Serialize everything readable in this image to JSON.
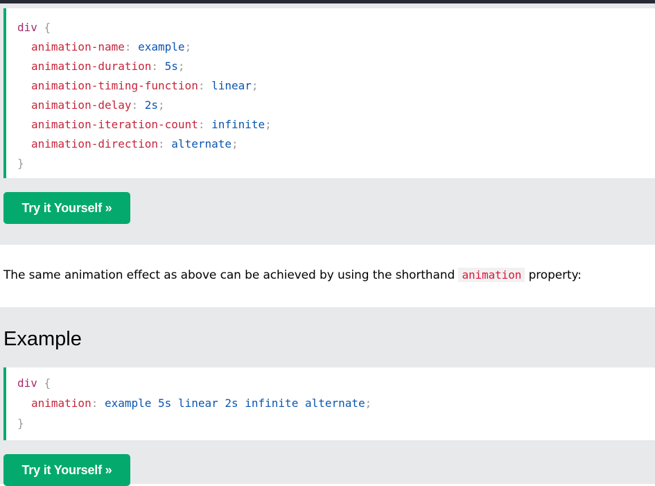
{
  "example1": {
    "code_lines": [
      {
        "sel": "div",
        "brace": "{"
      },
      {
        "prop": "animation-name",
        "val": "example"
      },
      {
        "prop": "animation-duration",
        "val": "5s"
      },
      {
        "prop": "animation-timing-function",
        "val": "linear"
      },
      {
        "prop": "animation-delay",
        "val": "2s"
      },
      {
        "prop": "animation-iteration-count",
        "val": "infinite"
      },
      {
        "prop": "animation-direction",
        "val": "alternate"
      },
      {
        "brace": "}"
      }
    ],
    "button_label": "Try it Yourself »"
  },
  "paragraph": {
    "before": "The same animation effect as above can be achieved by using the shorthand ",
    "code": "animation",
    "after": " property:"
  },
  "example2": {
    "heading": "Example",
    "code_lines": [
      {
        "sel": "div",
        "brace": "{"
      },
      {
        "prop": "animation",
        "val": "example 5s linear 2s infinite alternate"
      },
      {
        "brace": "}"
      }
    ],
    "button_label": "Try it Yourself »"
  },
  "colors": {
    "accent": "#04aa6d",
    "selector": "#a52a6a",
    "property": "#c7243a",
    "value": "#0a55b0",
    "inline_code": "#dc143c"
  }
}
